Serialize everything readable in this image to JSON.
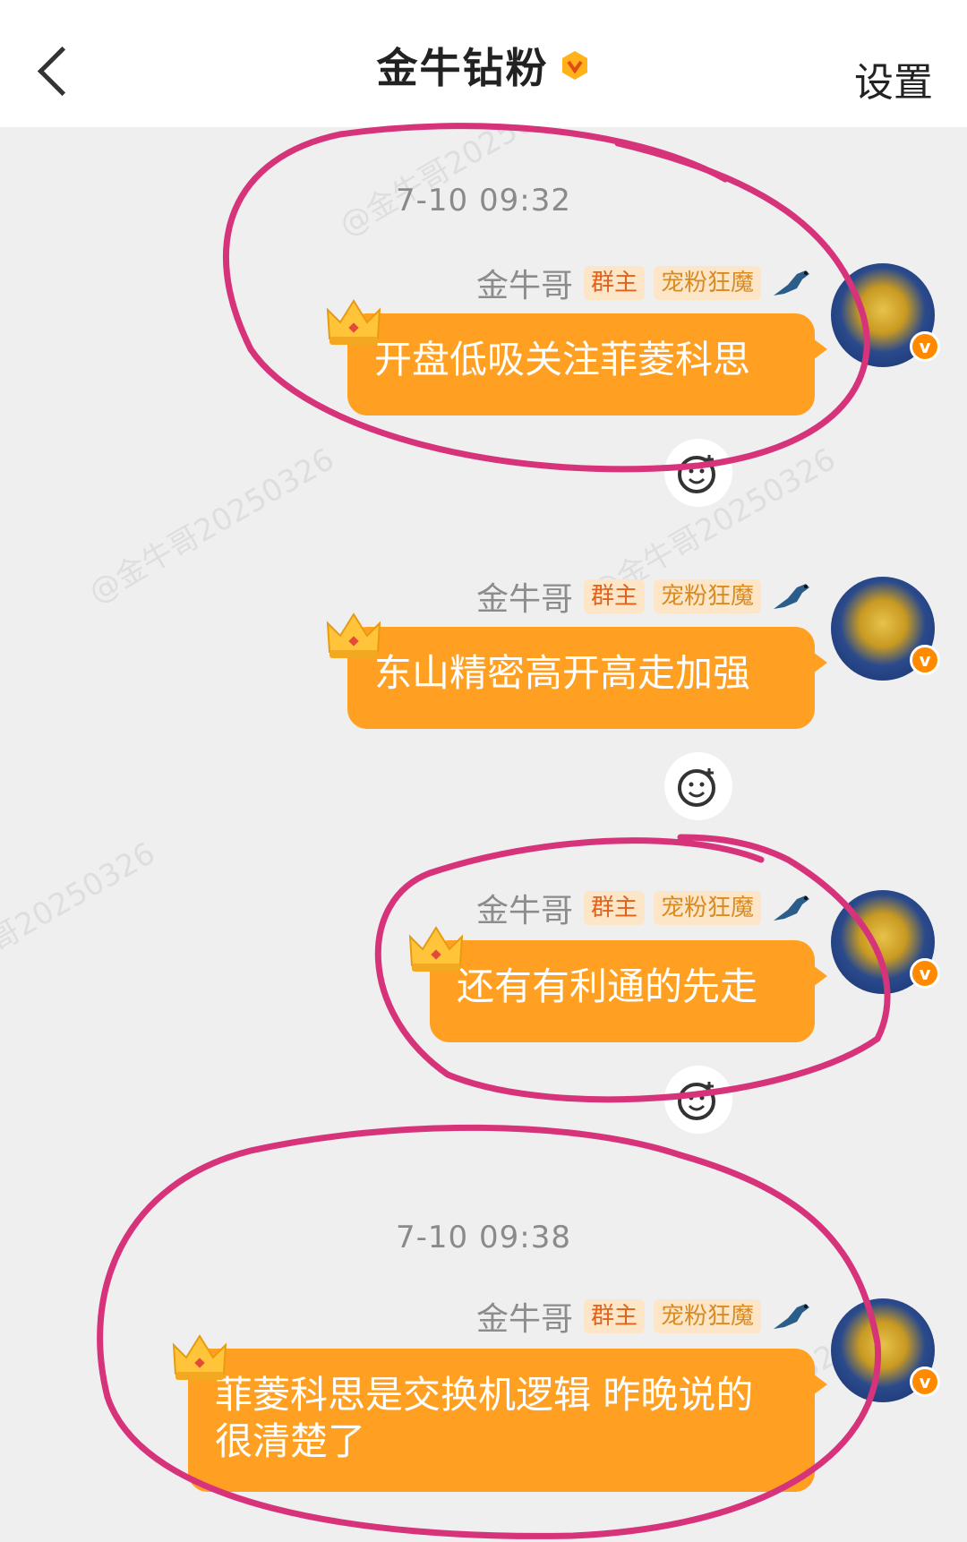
{
  "header": {
    "title": "金牛钻粉",
    "settings_label": "设置"
  },
  "timestamps": [
    "7-10 09:32",
    "7-10 09:38"
  ],
  "watermark": "@金牛哥20250326",
  "messages": [
    {
      "sender": "金牛哥",
      "tags": [
        "群主",
        "宠粉狂魔"
      ],
      "text": "开盘低吸关注菲菱科思"
    },
    {
      "sender": "金牛哥",
      "tags": [
        "群主",
        "宠粉狂魔"
      ],
      "text": "东山精密高开高走加强"
    },
    {
      "sender": "金牛哥",
      "tags": [
        "群主",
        "宠粉狂魔"
      ],
      "text": "还有有利通的先走"
    },
    {
      "sender": "金牛哥",
      "tags": [
        "群主",
        "宠粉狂魔"
      ],
      "text": "菲菱科思是交换机逻辑 昨晚说的很清楚了"
    }
  ],
  "colors": {
    "bubble": "#ffa022",
    "annotation": "#d6337a",
    "accent": "#ff8a00"
  },
  "icons": [
    "back-icon",
    "vip-icon",
    "crown-icon",
    "bird-icon",
    "avatar-verified-icon",
    "add-reaction-icon"
  ]
}
